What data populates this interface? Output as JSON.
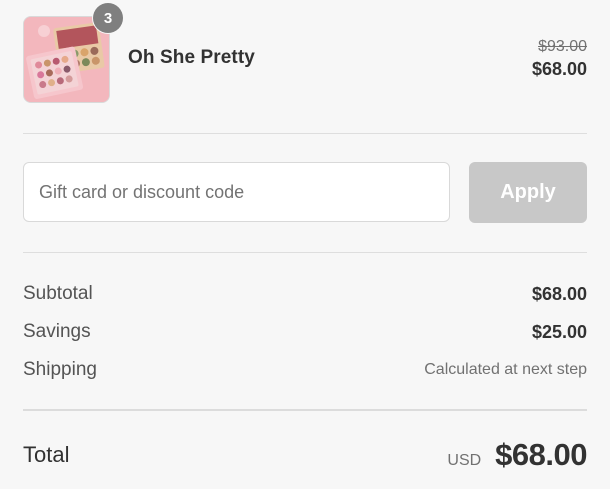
{
  "cart_item": {
    "name": "Oh She Pretty",
    "quantity": "3",
    "original_price": "$93.00",
    "price": "$68.00"
  },
  "discount": {
    "placeholder": "Gift card or discount code",
    "value": "",
    "apply_label": "Apply"
  },
  "summary": {
    "subtotal_label": "Subtotal",
    "subtotal_value": "$68.00",
    "savings_label": "Savings",
    "savings_value": "$25.00",
    "shipping_label": "Shipping",
    "shipping_value": "Calculated at next step"
  },
  "total": {
    "label": "Total",
    "currency": "USD",
    "amount": "$68.00"
  },
  "colors": {
    "background": "#f7f7f7",
    "apply_button": "#c8c8c8",
    "badge": "#7f7f7f",
    "thumbnail_pink": "#f2b9be"
  }
}
